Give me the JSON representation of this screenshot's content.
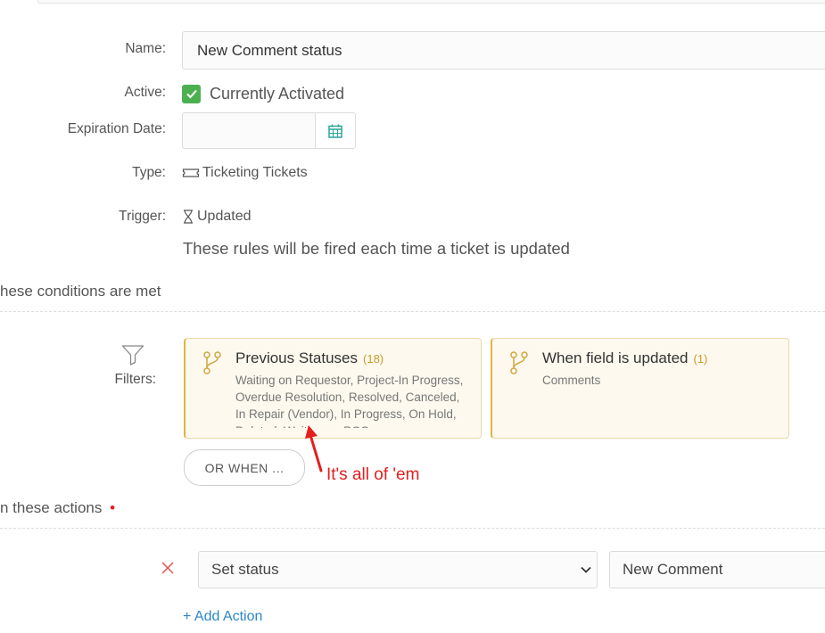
{
  "form": {
    "name_label": "Name:",
    "name_value": "New Comment status",
    "active_label": "Active:",
    "active_value": "Currently Activated",
    "expiration_label": "Expiration Date:",
    "expiration_value": "",
    "type_label": "Type:",
    "type_value": "Ticketing Tickets",
    "trigger_label": "Trigger:",
    "trigger_value": "Updated",
    "trigger_description": "These rules will be fired each time a ticket is updated"
  },
  "conditions": {
    "heading": "hese conditions are met",
    "filters_label": "Filters:",
    "cards": [
      {
        "title": "Previous Statuses",
        "count": "(18)",
        "body": "Waiting on Requestor, Project-In Progress, Overdue Resolution, Resolved, Canceled, In Repair (Vendor), In Progress, On Hold, Deleted, Waiting on POS..."
      },
      {
        "title": "When field is updated",
        "count": "(1)",
        "body": "Comments"
      }
    ],
    "or_when_label": "OR WHEN ..."
  },
  "annotation": {
    "text": "It's all of 'em",
    "color": "#e41e1e"
  },
  "actions": {
    "heading": "n these actions",
    "required_mark": "•",
    "row": {
      "action_value": "Set status",
      "target_value": "New Comment"
    },
    "add_label": "+ Add Action"
  },
  "colors": {
    "accent_green": "#4cb050",
    "teal_icon": "#2aa69a",
    "card_border": "#e3b341",
    "link_blue": "#2b87c8",
    "remove_red": "#e35555"
  }
}
